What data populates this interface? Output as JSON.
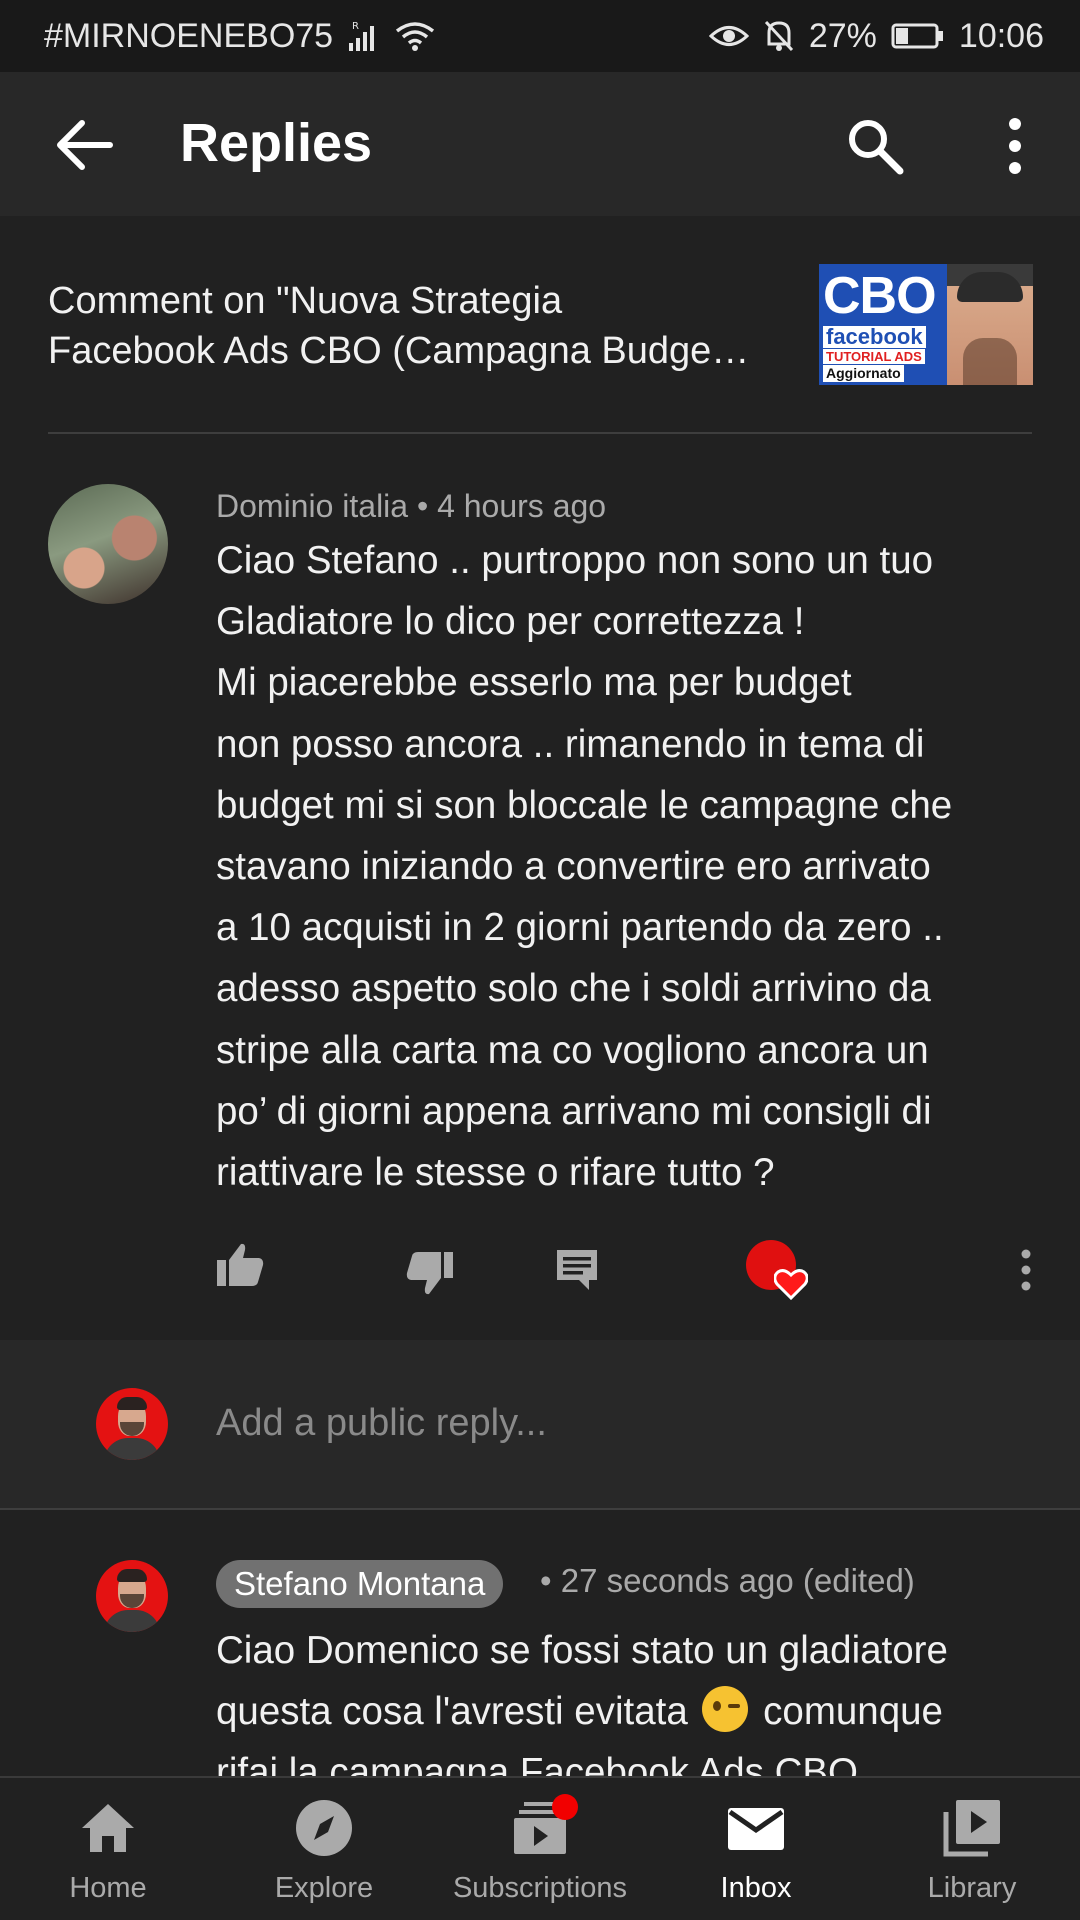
{
  "status_bar": {
    "carrier": "#MIRNOENEBO75",
    "battery": "27%",
    "time": "10:06"
  },
  "header": {
    "title": "Replies"
  },
  "video_reference": {
    "line1": "Comment on \"Nuova Strategia",
    "line2": "Facebook Ads CBO (Campagna Budge…",
    "thumbnail": {
      "big_text": "CBO",
      "brand": "facebook",
      "tag": "TUTORIAL ADS",
      "note": "Aggiornato"
    }
  },
  "comment": {
    "author": "Dominio italia",
    "separator": "•",
    "time": "4 hours ago",
    "lines": [
      "Ciao Stefano .. purtroppo non sono un tuo",
      "Gladiatore lo dico per correttezza !",
      "Mi piacerebbe esserlo ma per budget",
      "non posso ancora .. rimanendo in tema di",
      "budget mi si son bloccale le campagne che",
      "stavano iniziando a convertire ero arrivato",
      "a 10 acquisti in 2 giorni partendo da zero ..",
      "adesso aspetto solo che i soldi arrivino da",
      "stripe alla carta ma co vogliono ancora un",
      "po’ di giorni appena arrivano mi consigli di",
      "riattivare le stesse o rifare tutto ?"
    ]
  },
  "reply_box": {
    "placeholder": "Add a public reply..."
  },
  "reply": {
    "author": "Stefano Montana",
    "meta": "• 27 seconds ago (edited)",
    "line1": "Ciao Domenico se fossi stato un gladiatore",
    "line2_before": "questa cosa l'avresti evitata",
    "line2_after": "comunque",
    "line3": "rifai la campagna Facebook Ads CBO"
  },
  "bottom_nav": {
    "items": [
      {
        "label": "Home",
        "icon": "home-icon"
      },
      {
        "label": "Explore",
        "icon": "compass-icon"
      },
      {
        "label": "Subscriptions",
        "icon": "subscriptions-icon"
      },
      {
        "label": "Inbox",
        "icon": "mail-icon",
        "active": true
      },
      {
        "label": "Library",
        "icon": "library-icon"
      }
    ]
  },
  "colors": {
    "background": "#212121",
    "app_bar": "#282828",
    "accent_red": "#e41212",
    "secondary_text": "#aaaaaa"
  }
}
